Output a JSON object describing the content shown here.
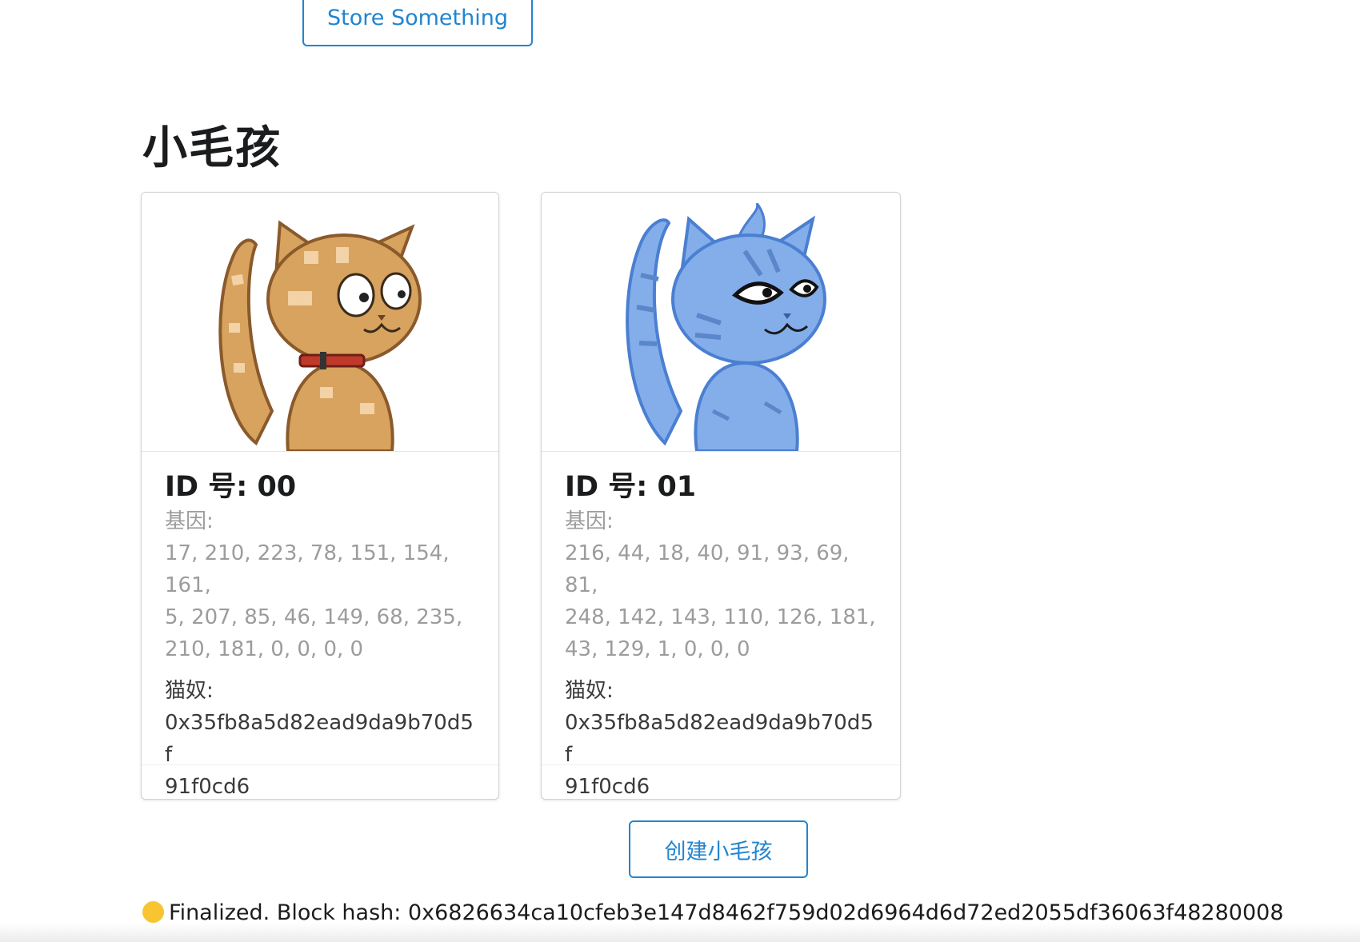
{
  "store_button": {
    "label": "Store Something"
  },
  "section": {
    "title": "小毛孩"
  },
  "kitties": [
    {
      "id_label": "ID 号: 00",
      "genes_label": "基因:",
      "genes_lines": [
        "17, 210, 223, 78, 151, 154, 161,",
        "5, 207, 85, 46, 149, 68, 235,",
        "210, 181, 0, 0, 0, 0"
      ],
      "owner_label": "猫奴:",
      "owner_lines": [
        "0x35fb8a5d82ead9da9b70d5f",
        "91f0cd6"
      ],
      "colors": {
        "body": "#d7a35f",
        "outline": "#8a5a2b",
        "collar": "#c0392b"
      }
    },
    {
      "id_label": "ID 号: 01",
      "genes_label": "基因:",
      "genes_lines": [
        "216, 44, 18, 40, 91, 93, 69, 81,",
        "248, 142, 143, 110, 126, 181,",
        "43, 129, 1, 0, 0, 0"
      ],
      "owner_label": "猫奴:",
      "owner_lines": [
        "0x35fb8a5d82ead9da9b70d5f",
        "91f0cd6"
      ],
      "colors": {
        "body": "#84aeea",
        "outline": "#4a7fd1"
      }
    }
  ],
  "create_button": {
    "label": "创建小毛孩"
  },
  "status": {
    "text": "Finalized. Block hash: 0x6826634ca10cfeb3e147d8462f759d02d6964d6d72ed2055df36063f48280008"
  }
}
